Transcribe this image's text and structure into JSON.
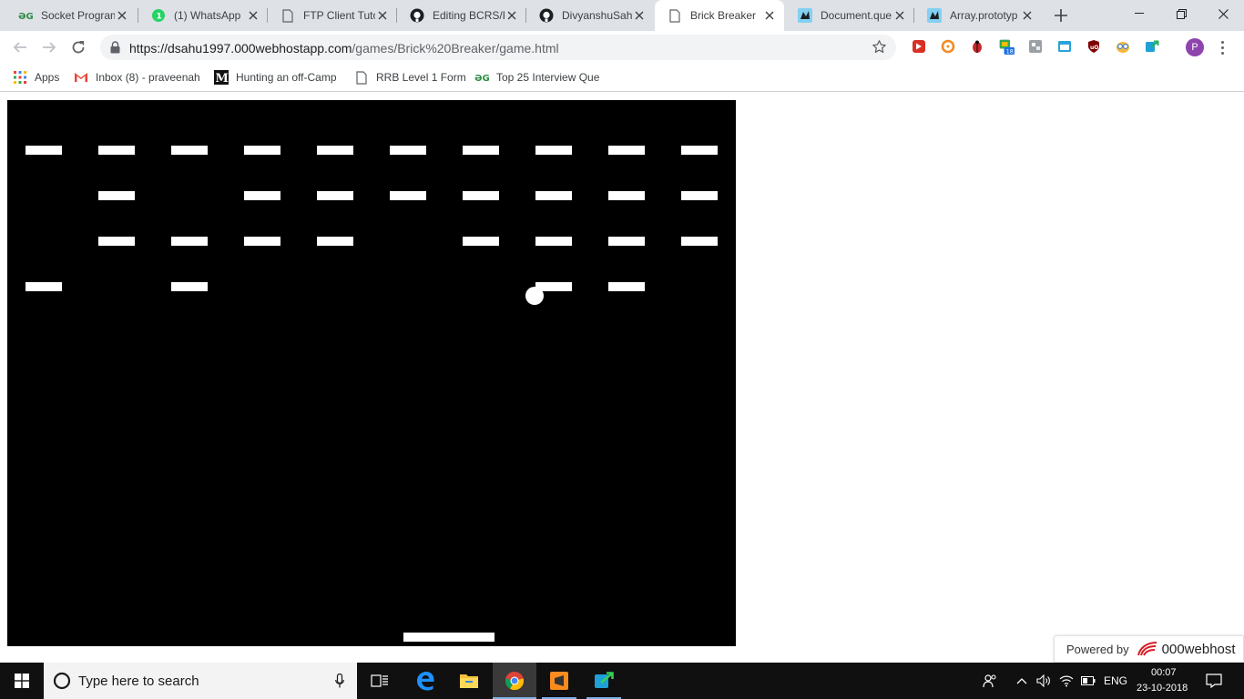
{
  "browser": {
    "tabs": [
      {
        "title": "Socket Program",
        "icon": "geeksforgeeks-icon",
        "active": false
      },
      {
        "title": "(1) WhatsApp",
        "icon": "whatsapp-icon",
        "active": false
      },
      {
        "title": "FTP Client Tuto",
        "icon": "page-icon",
        "active": false
      },
      {
        "title": "Editing BCRS/R",
        "icon": "github-icon",
        "active": false
      },
      {
        "title": "DivyanshuSahu",
        "icon": "github-icon",
        "active": false
      },
      {
        "title": "Brick Breaker",
        "icon": "page-icon",
        "active": true
      },
      {
        "title": "Document.que",
        "icon": "mdn-icon",
        "active": false
      },
      {
        "title": "Array.prototyp",
        "icon": "mdn-icon",
        "active": false
      }
    ],
    "url": {
      "host": "https://dsahu1997.000webhostapp.com",
      "path": "/games/Brick%20Breaker/game.html"
    },
    "extension_badge": "18",
    "profile_initial": "P",
    "bookmarks": [
      {
        "label": "Apps",
        "icon": "apps-grid-icon"
      },
      {
        "label": "Inbox (8) - praveenah",
        "icon": "gmail-icon"
      },
      {
        "label": "Hunting an off-Camp",
        "icon": "medium-icon"
      },
      {
        "label": "RRB Level 1 Form",
        "icon": "page-icon"
      },
      {
        "label": "Top 25 Interview Que",
        "icon": "geeksforgeeks-icon"
      }
    ]
  },
  "game": {
    "colors": {
      "background": "#000000",
      "foreground": "#ffffff"
    },
    "brick_columns": 10,
    "brick_rows": [
      [
        1,
        1,
        1,
        1,
        1,
        1,
        1,
        1,
        1,
        1
      ],
      [
        0,
        1,
        0,
        1,
        1,
        1,
        1,
        1,
        1,
        1
      ],
      [
        0,
        1,
        1,
        1,
        1,
        0,
        1,
        1,
        1,
        1
      ],
      [
        1,
        0,
        1,
        0,
        0,
        0,
        0,
        1,
        1,
        0
      ]
    ]
  },
  "powered_by": {
    "prefix": "Powered by",
    "brand": "000webhost"
  },
  "taskbar": {
    "search_placeholder": "Type here to search",
    "language": "ENG",
    "time": "00:07",
    "date": "23-10-2018"
  }
}
